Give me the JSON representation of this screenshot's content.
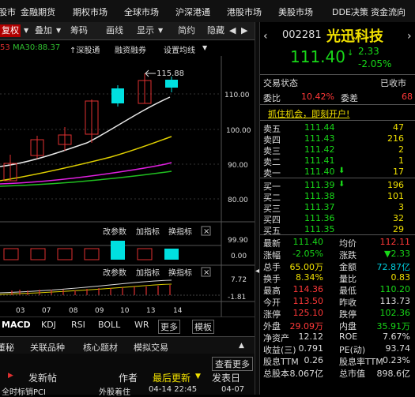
{
  "menu": [
    "股市",
    "金融期货",
    "期权市场",
    "全球市场",
    "沪深港通",
    "港股市场",
    "美股市场",
    "DDE决策",
    "资金流向"
  ],
  "toolbar": {
    "items": [
      "复权",
      "叠加",
      "筹码",
      "画线",
      "显示",
      "简约",
      "隐藏"
    ],
    "active": "复权"
  },
  "ma_row": {
    "left": "53",
    "ma30": "MA30:88.37",
    "link1": "↑深股通",
    "link2": "融资融券",
    "link3": "设置均线"
  },
  "main_chart": {
    "y_ticks": [
      "110.00",
      "100.00",
      "90.00",
      "80.00"
    ],
    "high_label": "115.88"
  },
  "indicator_panel": {
    "header": [
      "改参数",
      "加指标",
      "换指标"
    ],
    "close": "×",
    "y_ticks": [
      "99.90",
      "0.00"
    ]
  },
  "macd_panel": {
    "header": [
      "改参数",
      "加指标",
      "换指标"
    ],
    "close": "×",
    "y_ticks": [
      "7.72",
      "-1.81"
    ]
  },
  "x_dates": [
    "03",
    "07",
    "08",
    "09",
    "10",
    "13",
    "14"
  ],
  "indicator_tabs": {
    "items": [
      "MACD",
      "KDJ",
      "RSI",
      "BOLL",
      "WR",
      "更多",
      "模板"
    ],
    "selected": "MACD"
  },
  "subnav": {
    "items": [
      "董秘",
      "关联品种",
      "核心题材",
      "模拟交易"
    ],
    "collapse_icon": "▲"
  },
  "forum": {
    "post_button": "发新帖",
    "col_author": "作者",
    "col_latest": "最后更新",
    "col_latest_arrow": "▼",
    "col_post": "发表日",
    "view_more": "查看更多",
    "row": [
      "全时标销PCI",
      "外股着住",
      "04-14 22:45",
      "04-07"
    ]
  },
  "quote": {
    "code": "002281",
    "name": "光迅科技",
    "price": "111.40",
    "change": "2.33",
    "change_pct": "-2.05%",
    "status_label": "交易状态",
    "status_value": "已收市",
    "weibi_label": "委比",
    "weibi_value": "10.42%",
    "weicha_label": "委差",
    "weicha_value": "68",
    "promo": "抓住机会，即刻开户!",
    "sells": [
      {
        "label": "卖五",
        "price": "111.44",
        "vol": "47"
      },
      {
        "label": "卖四",
        "price": "111.43",
        "vol": "216"
      },
      {
        "label": "卖三",
        "price": "111.42",
        "vol": "2"
      },
      {
        "label": "卖二",
        "price": "111.41",
        "vol": "1"
      },
      {
        "label": "卖一",
        "price": "111.40",
        "vol": "17",
        "mark": "⬇"
      }
    ],
    "buys": [
      {
        "label": "买一",
        "price": "111.39",
        "vol": "196",
        "mark": "⬇"
      },
      {
        "label": "买二",
        "price": "111.38",
        "vol": "101"
      },
      {
        "label": "买三",
        "price": "111.37",
        "vol": "3"
      },
      {
        "label": "买四",
        "price": "111.36",
        "vol": "32"
      },
      {
        "label": "买五",
        "price": "111.35",
        "vol": "29"
      }
    ],
    "stats": [
      {
        "l1": "最新",
        "v1": "111.40",
        "c1": "dn",
        "l2": "均价",
        "v2": "112.11",
        "c2": "up"
      },
      {
        "l1": "涨幅",
        "v1": "-2.05%",
        "c1": "dn",
        "l2": "涨跌",
        "v2": "▼2.33",
        "c2": "dn"
      },
      {
        "l1": "总手",
        "v1": "65.00万",
        "c1": "yl",
        "l2": "金额",
        "v2": "72.87亿",
        "c2": "cy"
      },
      {
        "l1": "换手",
        "v1": "8.34%",
        "c1": "yl",
        "l2": "量比",
        "v2": "0.83",
        "c2": "yl"
      },
      {
        "l1": "最高",
        "v1": "114.36",
        "c1": "up",
        "l2": "最低",
        "v2": "110.20",
        "c2": "dn"
      },
      {
        "l1": "今开",
        "v1": "113.50",
        "c1": "up",
        "l2": "昨收",
        "v2": "113.73",
        "c2": "lbl"
      },
      {
        "l1": "涨停",
        "v1": "125.10",
        "c1": "up",
        "l2": "跌停",
        "v2": "102.36",
        "c2": "dn"
      },
      {
        "l1": "外盘",
        "v1": "29.09万",
        "c1": "up",
        "l2": "内盘",
        "v2": "35.91万",
        "c2": "dn"
      },
      {
        "l1": "净资产",
        "v1": "12.12",
        "c1": "lbl",
        "l2": "ROE",
        "v2": "7.67%",
        "c2": "lbl"
      },
      {
        "l1": "收益(三)",
        "v1": "0.791",
        "c1": "lbl",
        "l2": "PE(动)",
        "v2": "93.74",
        "c2": "lbl"
      },
      {
        "l1": "股息TTM",
        "v1": "0.26",
        "c1": "lbl",
        "l2": "股息率TTM",
        "v2": "0.23%",
        "c2": "lbl"
      },
      {
        "l1": "总股本",
        "v1": "8.067亿",
        "c1": "lbl",
        "l2": "总市值",
        "v2": "898.6亿",
        "c2": "lbl"
      }
    ]
  },
  "colors": {
    "up": "#ff3838",
    "down": "#18d818",
    "bg": "#000000",
    "accent": "#b00000"
  }
}
